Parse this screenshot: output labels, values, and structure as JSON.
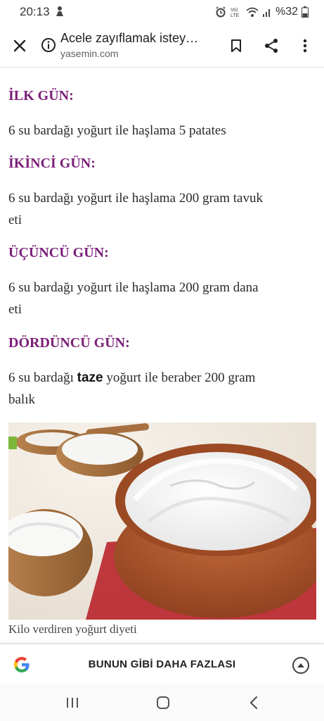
{
  "status_bar": {
    "time": "20:13",
    "battery": "%32",
    "icons": [
      "alarm-icon",
      "volte-icon",
      "wifi-icon",
      "signal-icon",
      "battery-icon"
    ]
  },
  "toolbar": {
    "title": "Acele zayıflamak istey…",
    "url": "yasemin.com",
    "icons": [
      "close-icon",
      "info-icon",
      "bookmark-icon",
      "share-icon",
      "more-vert-icon"
    ]
  },
  "article": {
    "days": [
      {
        "heading": "İLK GÜN:",
        "lines": [
          "6 su bardağı yoğurt ile haşlama 5 patates"
        ]
      },
      {
        "heading": "İKİNCİ GÜN:",
        "lines": [
          "6 su bardağı yoğurt ile haşlama 200 gram tavuk",
          "eti"
        ]
      },
      {
        "heading": "ÜÇÜNCÜ GÜN:",
        "lines": [
          "6 su bardağı yoğurt ile haşlama 200 gram dana",
          "eti"
        ]
      },
      {
        "heading": "DÖRDÜNCÜ GÜN:",
        "lines_before_bold": "6 su bardağı ",
        "bold": "taze",
        "lines_after_bold": " yoğurt ile beraber 200 gram",
        "line2": "balık"
      }
    ],
    "image_caption": "Kilo verdiren yoğurt diyeti"
  },
  "more_bar": {
    "label": "BUNUN GİBİ DAHA FAZLASI",
    "colors": {
      "blue": "#4285F4",
      "red": "#EA4335",
      "yellow": "#FBBC05",
      "green": "#34A853"
    }
  },
  "colors": {
    "heading": "#7b1f78"
  },
  "nav_bar": {
    "icons": [
      "recents-icon",
      "home-icon",
      "back-icon"
    ]
  }
}
